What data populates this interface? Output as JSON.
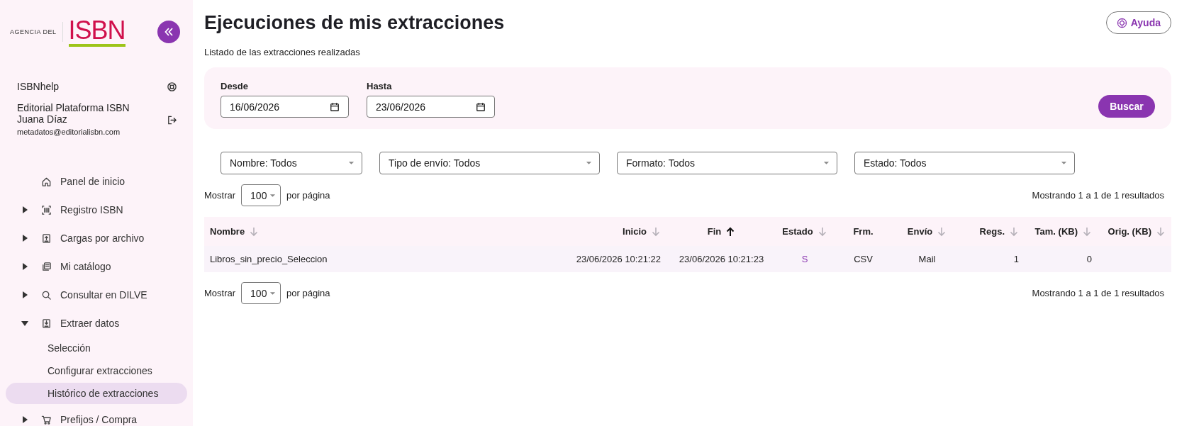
{
  "sidebar": {
    "logo": {
      "prefix": "AGENCIA DEL",
      "name": "ISBN"
    },
    "help_link": "ISBNhelp",
    "user": {
      "organization": "Editorial Plataforma ISBN",
      "name": "Juana Díaz",
      "email": "metadatos@editorialisbn.com"
    },
    "nav": [
      {
        "label": "Panel de inicio",
        "expandable": false,
        "selected": false
      },
      {
        "label": "Registro ISBN",
        "expandable": true,
        "expanded": false,
        "selected": false
      },
      {
        "label": "Cargas por archivo",
        "expandable": true,
        "expanded": false,
        "selected": false
      },
      {
        "label": "Mi catálogo",
        "expandable": true,
        "expanded": false,
        "selected": false
      },
      {
        "label": "Consultar en DILVE",
        "expandable": true,
        "expanded": false,
        "selected": false
      },
      {
        "label": "Extraer datos",
        "expandable": true,
        "expanded": true,
        "selected": false,
        "children": [
          {
            "label": "Selección",
            "selected": false
          },
          {
            "label": "Configurar extracciones",
            "selected": false
          },
          {
            "label": "Histórico de extracciones",
            "selected": true
          }
        ]
      },
      {
        "label": "Prefijos / Compra",
        "expandable": true,
        "expanded": false,
        "selected": false
      }
    ]
  },
  "page": {
    "title": "Ejecuciones de mis extracciones",
    "subtitle": "Listado de las extracciones realizadas",
    "help_button": "Ayuda"
  },
  "date_filter": {
    "fields": [
      {
        "label": "Desde",
        "value": "16/06/2026"
      },
      {
        "label": "Hasta",
        "value": "23/06/2026"
      }
    ],
    "search_button": "Buscar"
  },
  "dropdowns": [
    {
      "value": "Nombre: Todos"
    },
    {
      "value": "Tipo de envío: Todos"
    },
    {
      "value": "Formato: Todos"
    },
    {
      "value": "Estado: Todos"
    }
  ],
  "pagination_top": {
    "before": "Mostrar",
    "per_page": "100",
    "after": "por página",
    "summary": "Mostrando 1 a 1 de 1 resultados"
  },
  "table": {
    "columns": [
      {
        "label": "Nombre",
        "kind": "text",
        "sortable": true,
        "sorted": false
      },
      {
        "label": "Inicio",
        "kind": "date",
        "sortable": true,
        "sorted": false
      },
      {
        "label": "Fin",
        "kind": "center",
        "sortable": true,
        "sorted": true
      },
      {
        "label": "Estado",
        "kind": "status",
        "sortable": true,
        "sorted": false
      },
      {
        "label": "Frm.",
        "kind": "center",
        "sortable": false
      },
      {
        "label": "Envío",
        "kind": "center",
        "sortable": true,
        "sorted": false
      },
      {
        "label": "Regs.",
        "kind": "number",
        "sortable": true,
        "sorted": false
      },
      {
        "label": "Tam. (KB)",
        "kind": "number",
        "sortable": true,
        "sorted": false
      },
      {
        "label": "Orig. (KB)",
        "kind": "number",
        "sortable": true,
        "sorted": false
      }
    ],
    "rows": [
      [
        "Libros_sin_precio_Seleccion",
        "23/06/2026 10:21:22",
        "23/06/2026 10:21:23",
        "S",
        "CSV",
        "Mail",
        "1",
        "0",
        ""
      ]
    ]
  },
  "pagination_bottom": {
    "before": "Mostrar",
    "per_page": "100",
    "after": "por página",
    "summary": "Mostrando 1 a 1 de 1 resultados"
  }
}
